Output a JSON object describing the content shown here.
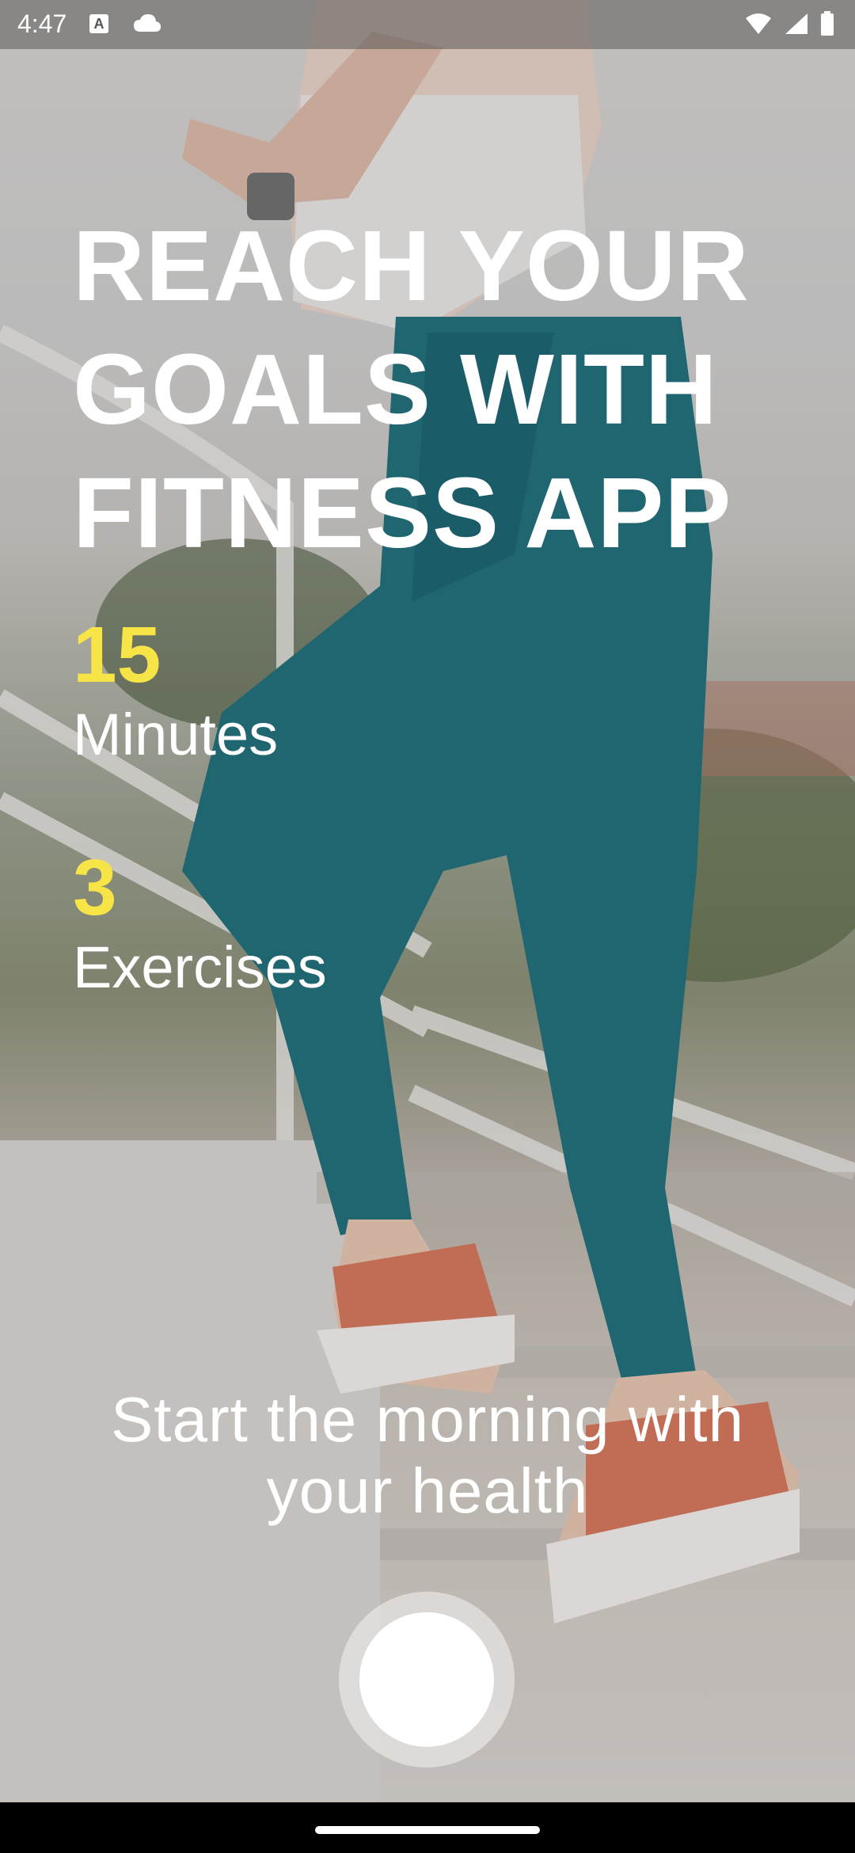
{
  "status_bar": {
    "time": "4:47",
    "notification_icon_letter": "A",
    "icons": [
      "a-notification-icon",
      "cloud-icon",
      "wifi-icon",
      "signal-icon",
      "battery-icon"
    ]
  },
  "headline": {
    "line1": "REACH YOUR",
    "line2": "GOALS WITH",
    "line3": "FITNESS APP"
  },
  "stats": [
    {
      "number": "15",
      "label": "Minutes"
    },
    {
      "number": "3",
      "label": "Exercises"
    }
  ],
  "tagline": {
    "line1": "Start the morning with",
    "line2": "your health"
  },
  "colors": {
    "accent": "#f7e547",
    "text": "#ffffff"
  }
}
